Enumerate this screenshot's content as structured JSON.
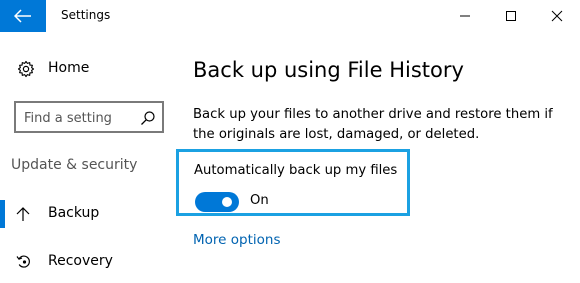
{
  "titlebar": {
    "title": "Settings",
    "back_icon": "back-arrow-icon",
    "accent": "#0078d7"
  },
  "sidebar": {
    "home_label": "Home",
    "search_placeholder": "Find a setting",
    "section_label": "Update & security",
    "items": [
      {
        "label": "Backup",
        "icon": "backup-arrow-icon",
        "active": true
      },
      {
        "label": "Recovery",
        "icon": "recovery-icon",
        "active": false
      }
    ]
  },
  "main": {
    "title": "Back up using File History",
    "description": "Back up your files to another drive and restore them if the originals are lost, damaged, or deleted.",
    "toggle": {
      "label": "Automatically back up my files",
      "state": "On",
      "on": true
    },
    "more_options": "More options",
    "highlight_color": "#1ba1e2",
    "link_color": "#0063b1"
  }
}
